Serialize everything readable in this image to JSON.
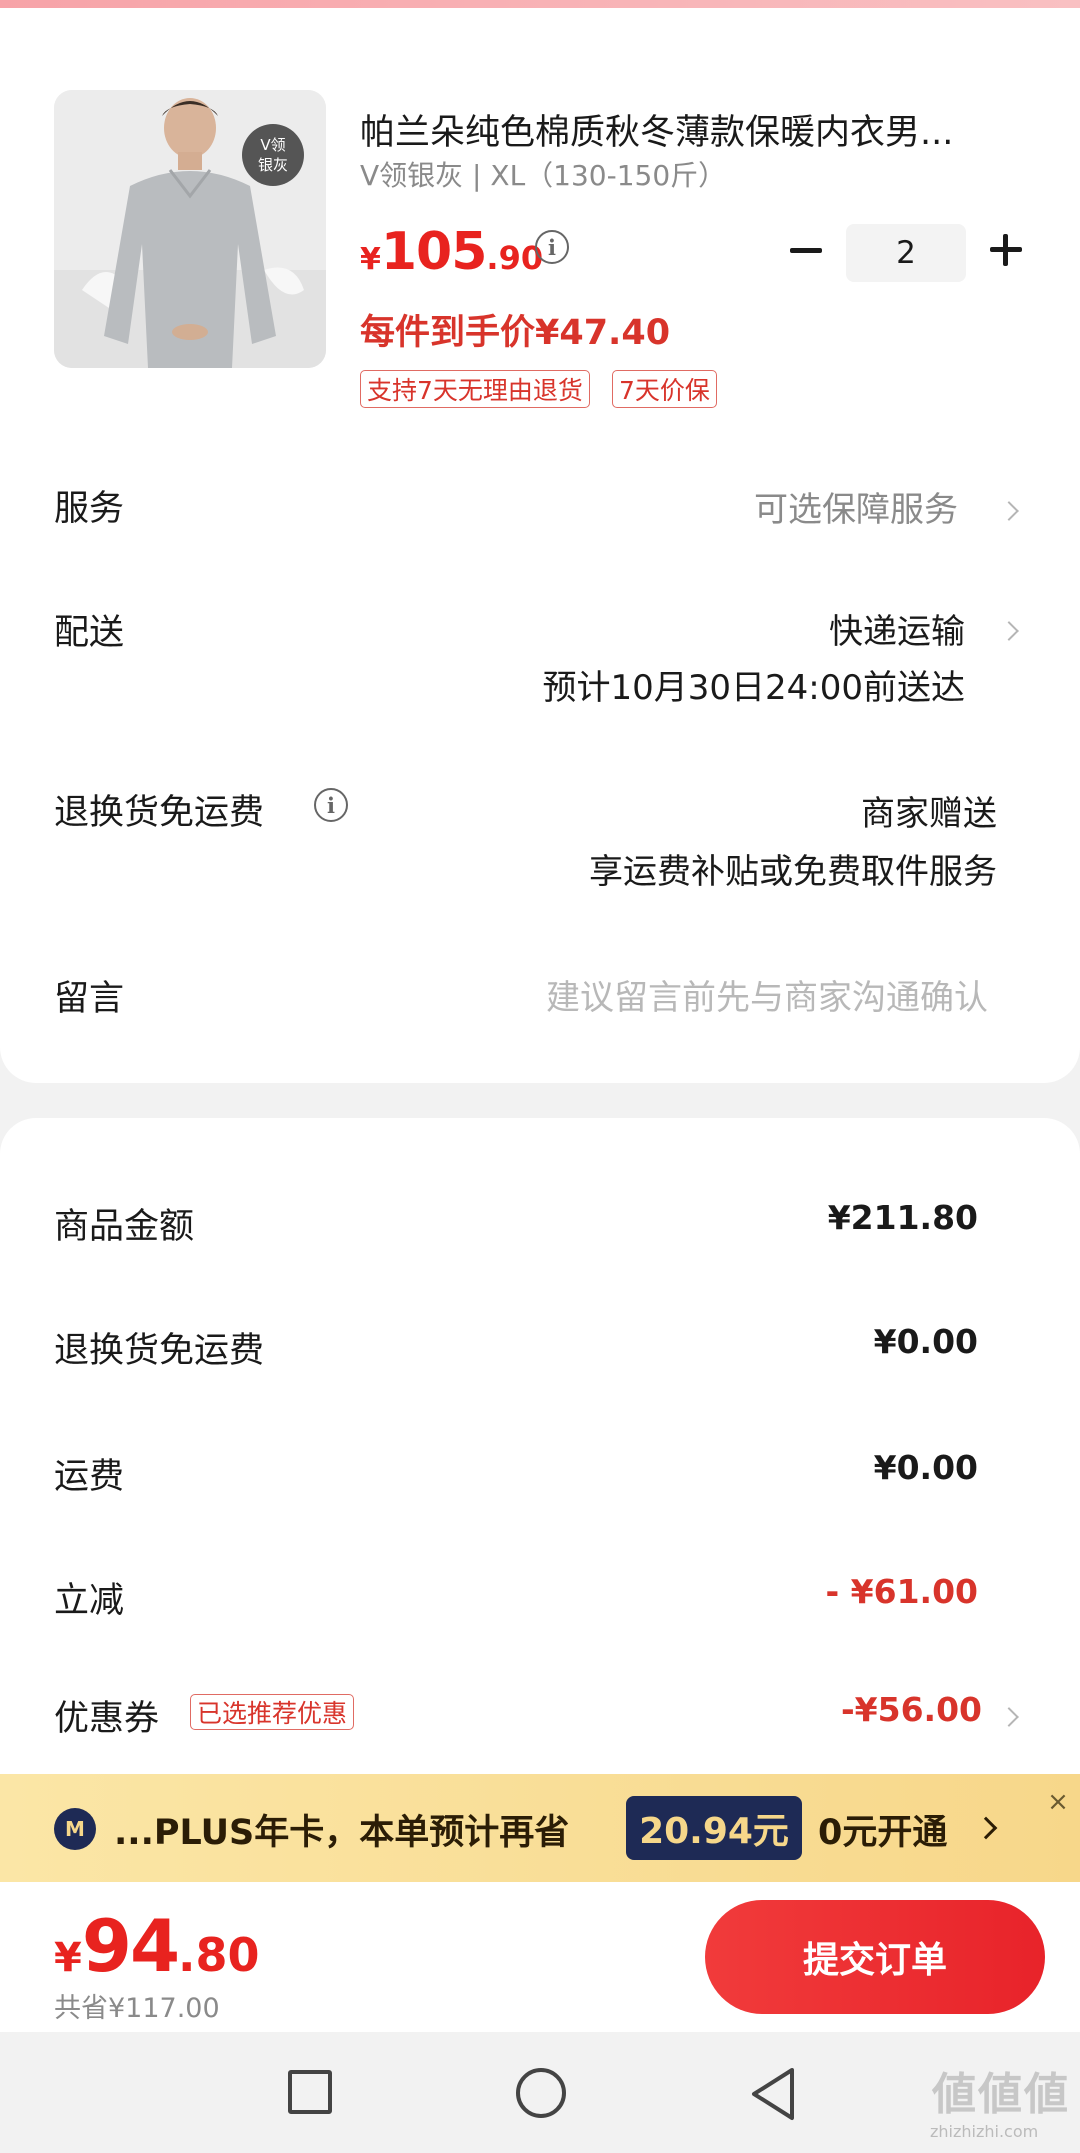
{
  "product": {
    "title": "帕兰朵纯色棉质秋冬薄款保暖内衣男...",
    "spec": "V领银灰 | XL（130-150斤）",
    "thumb_tag_line1": "V领",
    "thumb_tag_line2": "银灰",
    "price_symbol": "¥",
    "price_int": "105",
    "price_dec": ".90",
    "quantity": "2",
    "unit_price_text": "每件到手价¥47.40",
    "tags": [
      "支持7天无理由退货",
      "7天价保"
    ]
  },
  "rows": {
    "service_label": "服务",
    "service_value": "可选保障服务",
    "delivery_label": "配送",
    "delivery_method": "快递运输",
    "delivery_eta": "预计10月30日24:00前送达",
    "return_label": "退换货免运费",
    "return_value": "商家赠送",
    "return_note": "享运费补贴或免费取件服务",
    "message_label": "留言",
    "message_placeholder": "建议留言前先与商家沟通确认"
  },
  "summary": {
    "goods_label": "商品金额",
    "goods_value": "¥211.80",
    "return_fee_label": "退换货免运费",
    "return_fee_value": "¥0.00",
    "shipping_label": "运费",
    "shipping_value": "¥0.00",
    "discount_label": "立减",
    "discount_value": "- ¥61.00",
    "coupon_label": "优惠券",
    "coupon_tag": "已选推荐优惠",
    "coupon_value": "-¥56.00"
  },
  "plus_banner": {
    "icon_text": "M",
    "text": "...PLUS年卡，本单预计再省",
    "amount": "20.94元",
    "cta": "0元开通",
    "close": "×"
  },
  "bottom": {
    "total_symbol": "¥",
    "total_int": "94",
    "total_dec": ".80",
    "saved_text": "共省¥117.00",
    "submit_label": "提交订单"
  },
  "watermark": {
    "main": "値値値",
    "sub": "zhizhizhi.com"
  },
  "colors": {
    "price_red": "#e8231f",
    "plus_navy": "#1e2a55",
    "plus_gold": "#f6d78a"
  }
}
